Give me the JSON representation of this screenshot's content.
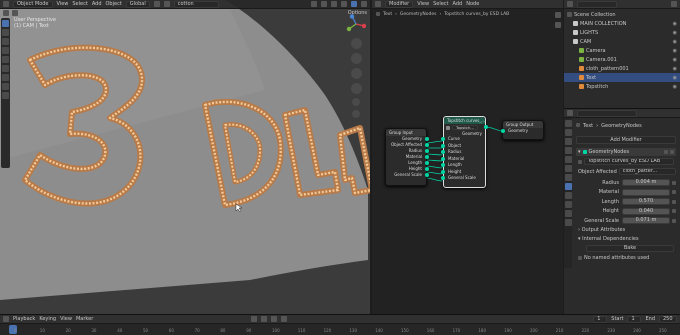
{
  "viewport": {
    "mode": "Object Mode",
    "menus": [
      "View",
      "Select",
      "Add",
      "Object"
    ],
    "transform": "Global",
    "search_value": "cotton",
    "options": "Options",
    "info_line1": "User Perspective",
    "info_line2": "(1) CAM | Text",
    "letters": "3DL"
  },
  "node_editor": {
    "menus": [
      "View",
      "Select",
      "Add",
      "Node"
    ],
    "editor_type": "Modifier",
    "object": "Text",
    "modifier": "GeometryNodes",
    "nodegroup": "Topstitch curves_by ESD LAB",
    "group_input": {
      "title": "Group Input",
      "outputs": [
        "Geometry",
        "Object Affected",
        "Radius",
        "Material",
        "Length",
        "Height",
        "General Scale"
      ]
    },
    "topstitch": {
      "title": "Topstitch curves_...",
      "field": "Topstch...",
      "output": "Geometry",
      "inputs": [
        "Curve",
        "Object",
        "Radius",
        "Material",
        "Length",
        "Height",
        "General Scale"
      ]
    },
    "group_output": {
      "title": "Group Output",
      "inputs": [
        "Geometry"
      ]
    }
  },
  "outliner": {
    "title": "Scene Collection",
    "items": [
      {
        "label": "MAIN COLLECTION",
        "depth": 1,
        "selected": false
      },
      {
        "label": "LIGHTS",
        "depth": 1,
        "selected": false
      },
      {
        "label": "CAM",
        "depth": 1,
        "selected": false
      },
      {
        "label": "Camera",
        "depth": 2,
        "selected": false
      },
      {
        "label": "Camera.001",
        "depth": 2,
        "selected": false
      },
      {
        "label": "cloth_pattern001",
        "depth": 2,
        "selected": false
      },
      {
        "label": "Text",
        "depth": 2,
        "selected": true
      },
      {
        "label": "Topstitch",
        "depth": 2,
        "selected": false
      }
    ]
  },
  "properties": {
    "crumb_object": "Text",
    "crumb_modifier": "GeometryNodes",
    "add_modifier": "Add Modifier",
    "modifier_name": "GeometryNodes",
    "nodegroup": "Topstitch curves_by ESD LAB",
    "object_affected_label": "Object Affected",
    "object_affected_value": "cloth_patter...",
    "fields": [
      {
        "label": "Radius",
        "value": "0.004 m"
      },
      {
        "label": "Material",
        "value": ""
      },
      {
        "label": "Length",
        "value": "0.570"
      },
      {
        "label": "Height",
        "value": "0.040"
      },
      {
        "label": "General Scale",
        "value": "0.071 m"
      }
    ],
    "output_attributes": "Output Attributes",
    "internal_dependencies": "Internal Dependencies",
    "bake": "Bake",
    "no_named": "No named attributes used"
  },
  "timeline": {
    "menus": [
      "Playback",
      "Keying",
      "View",
      "Marker"
    ],
    "start_label": "Start",
    "start": "1",
    "end_label": "End",
    "end": "250",
    "current": "1",
    "ticks": [
      "0",
      "10",
      "20",
      "30",
      "40",
      "50",
      "60",
      "70",
      "80",
      "90",
      "100",
      "110",
      "120",
      "130",
      "140",
      "150",
      "160",
      "170",
      "180",
      "190",
      "200",
      "210",
      "220",
      "230",
      "240",
      "250"
    ]
  },
  "colors": {
    "accent": "#4a72b0",
    "socket": "#00d6a3",
    "stitch": "#d89a62",
    "node_header_group": "#383838",
    "node_header_topstitch": "#1f5a4a"
  }
}
